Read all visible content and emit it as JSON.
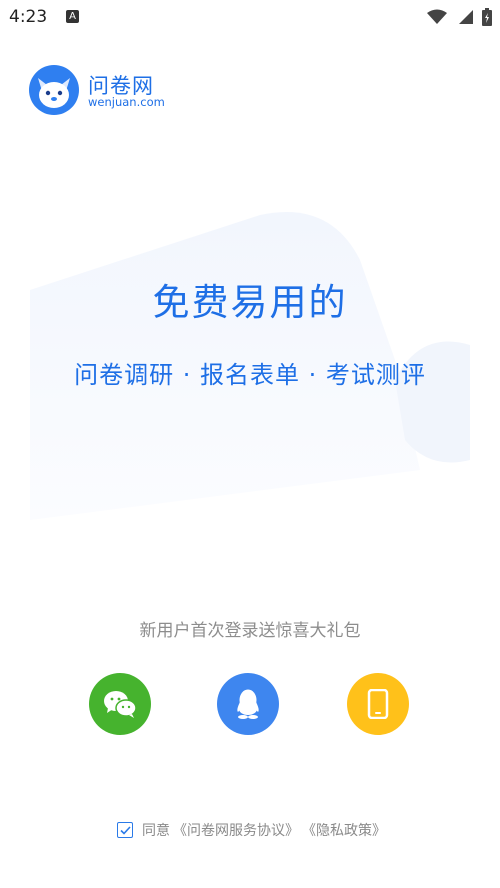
{
  "status_bar": {
    "time": "4:23",
    "notification_icon": "A"
  },
  "brand": {
    "name": "问卷网",
    "url": "wenjuan.com",
    "color": "#1e6fe6"
  },
  "hero": {
    "headline": "免费易用的",
    "tagline": "问卷调研 · 报名表单 · 考试测评"
  },
  "login": {
    "promo_text": "新用户首次登录送惊喜大礼包",
    "options": [
      {
        "icon": "wechat-icon",
        "color": "#46b32e"
      },
      {
        "icon": "qq-icon",
        "color": "#3e86ef"
      },
      {
        "icon": "phone-icon",
        "color": "#ffc11a"
      }
    ]
  },
  "agreement": {
    "checked": true,
    "prefix": "同意",
    "terms_link": "《问卷网服务协议》",
    "privacy_link": "《隐私政策》"
  }
}
